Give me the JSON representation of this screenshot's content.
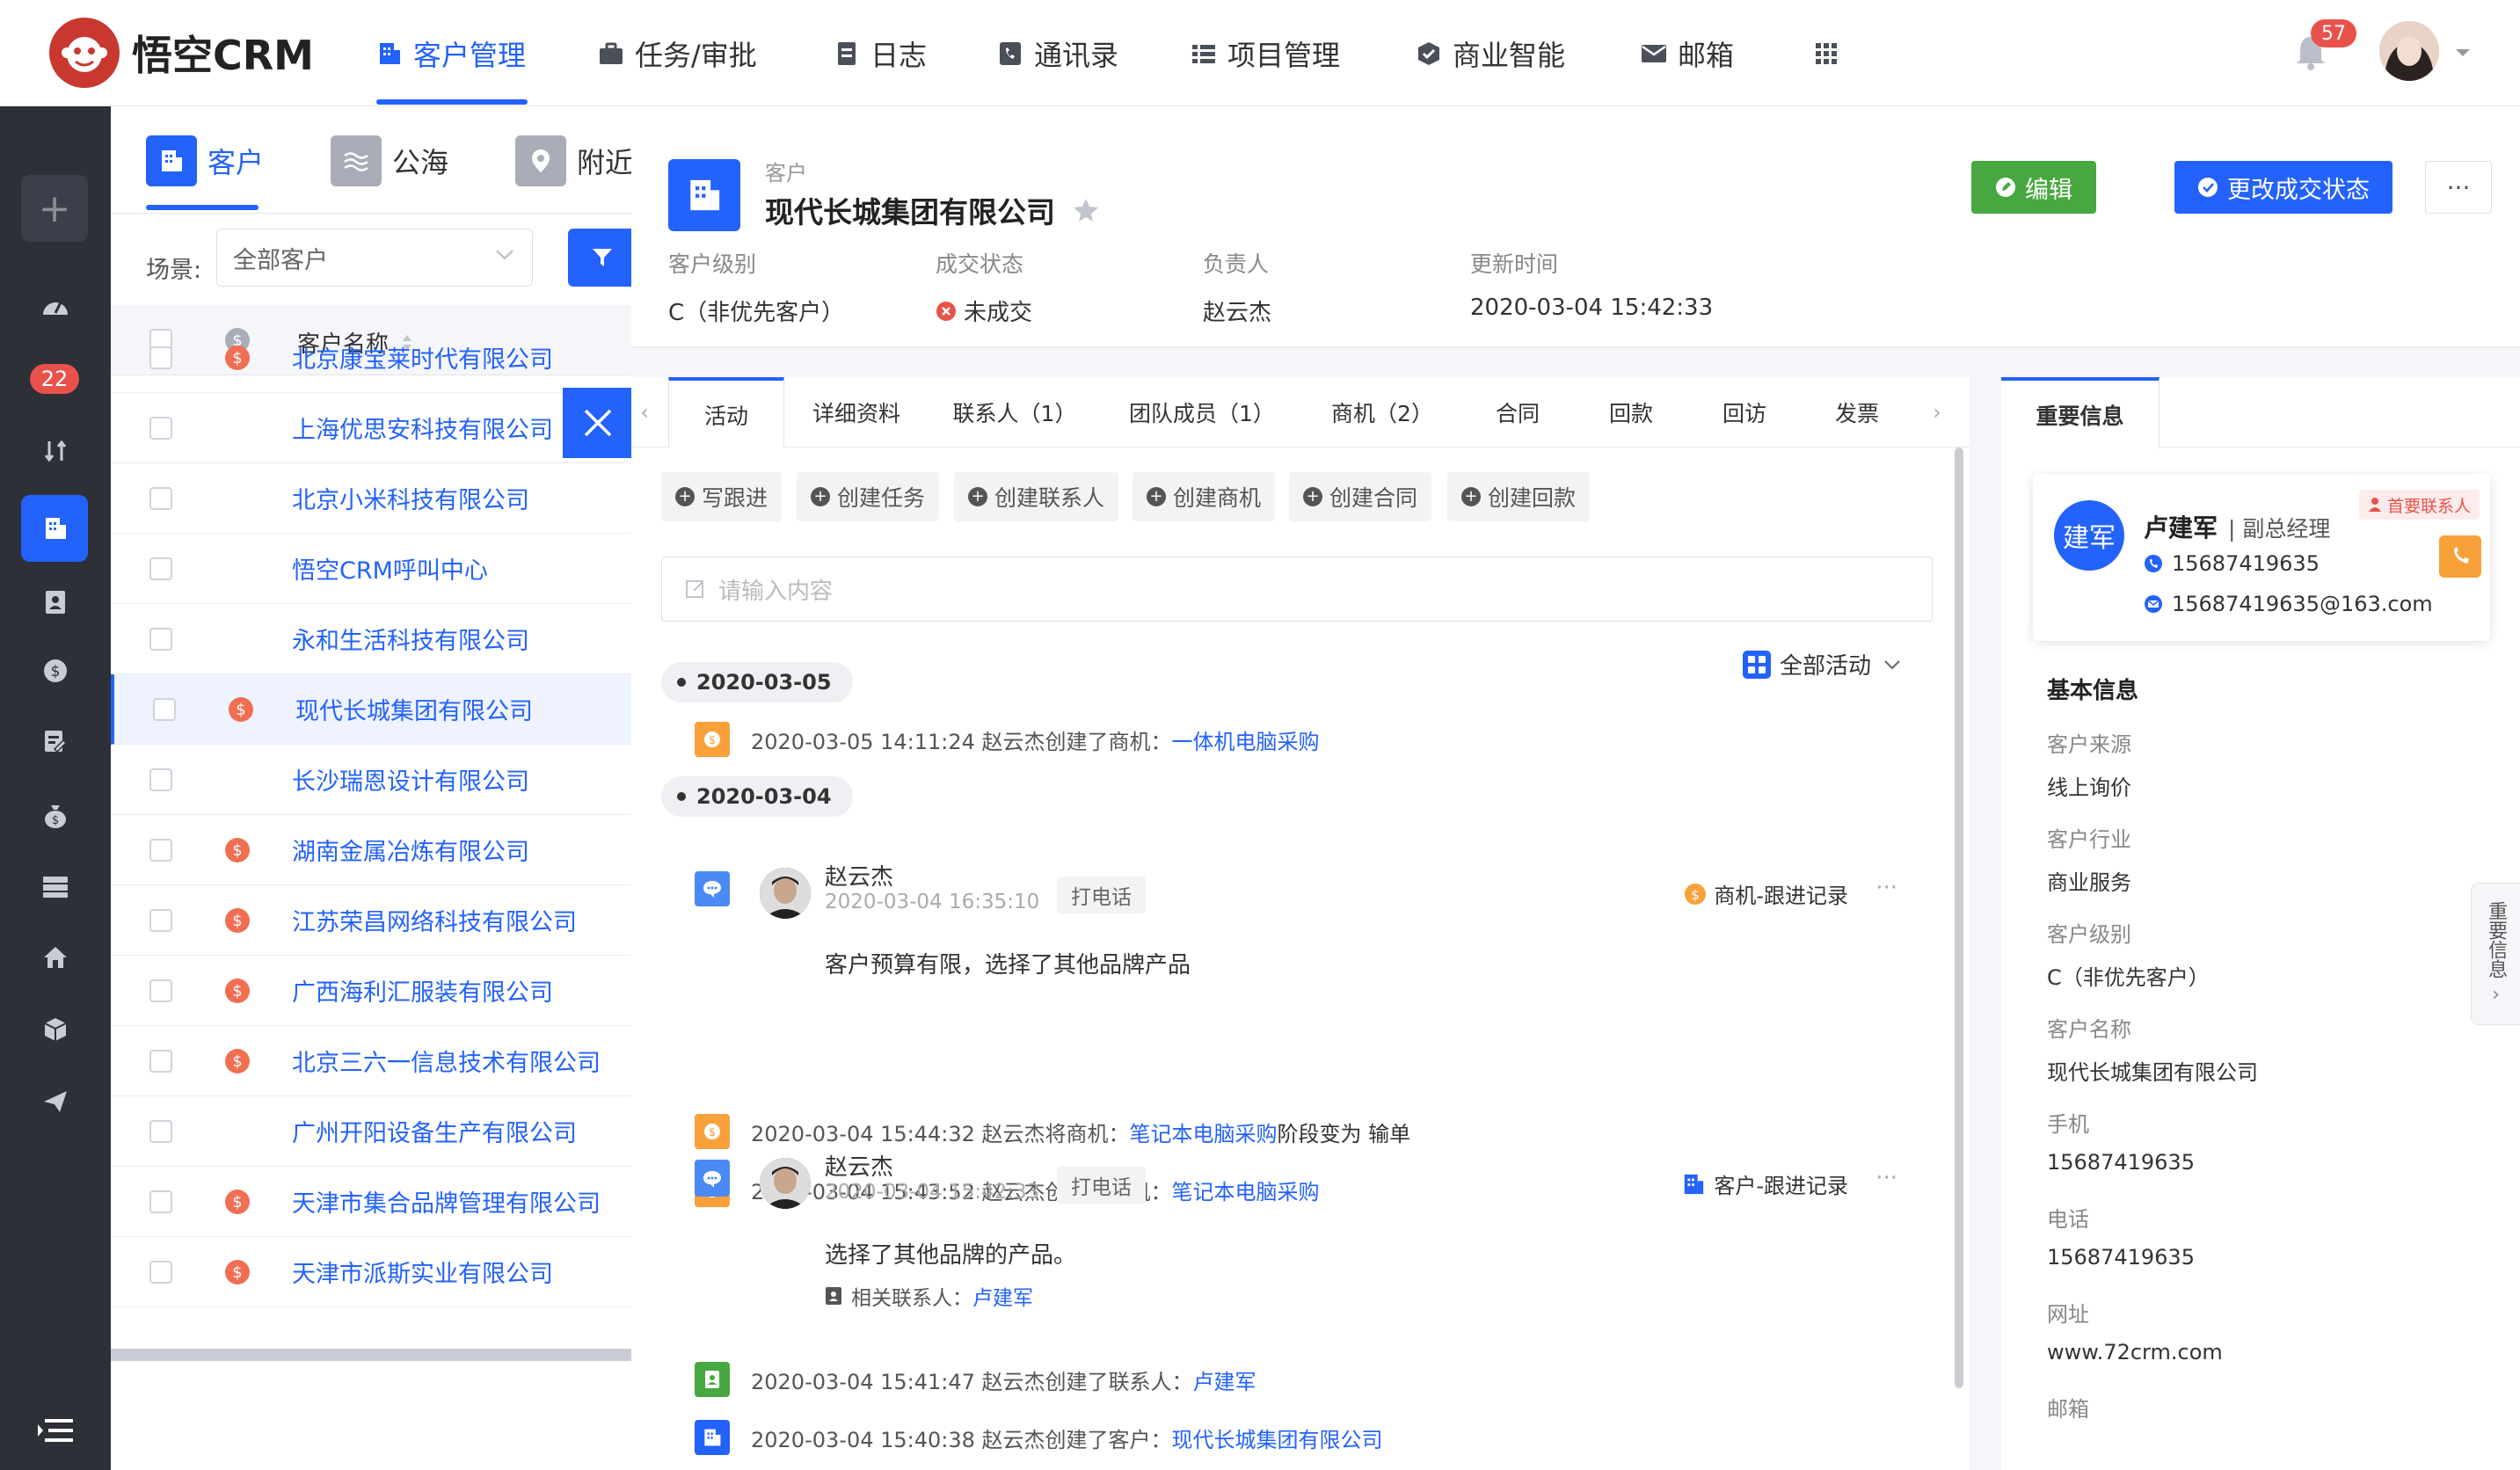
{
  "app": {
    "logo_text": "悟空CRM"
  },
  "nav": {
    "items": [
      {
        "label": "客户管理",
        "icon": "customer-icon",
        "active": true
      },
      {
        "label": "任务/审批",
        "icon": "briefcase-icon"
      },
      {
        "label": "日志",
        "icon": "log-icon"
      },
      {
        "label": "通讯录",
        "icon": "contacts-icon"
      },
      {
        "label": "项目管理",
        "icon": "project-icon"
      },
      {
        "label": "商业智能",
        "icon": "bi-icon"
      },
      {
        "label": "邮箱",
        "icon": "mail-icon"
      }
    ],
    "notification_count": "57"
  },
  "sidebar": {
    "badge": "22"
  },
  "left_panel": {
    "tabs": [
      {
        "label": "客户",
        "active": true
      },
      {
        "label": "公海"
      },
      {
        "label": "附近客户"
      }
    ],
    "scene_label": "场景:",
    "scene_value": "全部客户",
    "column_header": "客户名称",
    "rows": [
      {
        "name": "北京康宝莱时代有限公司",
        "deal": true
      },
      {
        "name": "上海优思安科技有限公司",
        "deal": false
      },
      {
        "name": "北京小米科技有限公司",
        "deal": false
      },
      {
        "name": "悟空CRM呼叫中心",
        "deal": false
      },
      {
        "name": "永和生活科技有限公司",
        "deal": false
      },
      {
        "name": "现代长城集团有限公司",
        "deal": true,
        "selected": true
      },
      {
        "name": "长沙瑞恩设计有限公司",
        "deal": false
      },
      {
        "name": "湖南金属冶炼有限公司",
        "deal": true
      },
      {
        "name": "江苏荣昌网络科技有限公司",
        "deal": true
      },
      {
        "name": "广西海利汇服装有限公司",
        "deal": true
      },
      {
        "name": "北京三六一信息技术有限公司",
        "deal": true
      },
      {
        "name": "广州开阳设备生产有限公司",
        "deal": false
      },
      {
        "name": "天津市集合品牌管理有限公司",
        "deal": true
      },
      {
        "name": "天津市派斯实业有限公司",
        "deal": true
      }
    ]
  },
  "detail": {
    "subtitle": "客户",
    "title": "现代长城集团有限公司",
    "edit_label": "编辑",
    "status_label": "更改成交状态",
    "more_label": "···",
    "meta": [
      {
        "label": "客户级别",
        "value": "C（非优先客户）"
      },
      {
        "label": "成交状态",
        "value": "未成交"
      },
      {
        "label": "负责人",
        "value": "赵云杰"
      },
      {
        "label": "更新时间",
        "value": "2020-03-04 15:42:33"
      }
    ],
    "tabs": [
      "活动",
      "详细资料",
      "联系人（1）",
      "团队成员（1）",
      "商机（2）",
      "合同",
      "回款",
      "回访",
      "发票"
    ],
    "actions": [
      "写跟进",
      "创建任务",
      "创建联系人",
      "创建商机",
      "创建合同",
      "创建回款"
    ],
    "input_placeholder": "请输入内容",
    "filter_label": "全部活动",
    "timeline": {
      "date1": "2020-03-05",
      "date2": "2020-03-04",
      "e1": {
        "text": "2020-03-05 14:11:24 赵云杰创建了商机：",
        "link": "一体机电脑采购"
      },
      "card1": {
        "name": "赵云杰",
        "time": "2020-03-04 16:35:10",
        "type": "打电话",
        "tag": "商机-跟进记录",
        "text": "客户预算有限，选择了其他品牌产品"
      },
      "e2": {
        "text": "2020-03-04 15:44:32 赵云杰将商机：",
        "link": "笔记本电脑采购",
        "suffix": " 阶段变为 输单"
      },
      "e3": {
        "text": "2020-03-04 15:43:52 赵云杰创建了商机：",
        "link": "笔记本电脑采购"
      },
      "card2": {
        "name": "赵云杰",
        "time": "2020-03-04 15:42:33",
        "type": "打电话",
        "tag": "客户-跟进记录",
        "text": "选择了其他品牌的产品。",
        "contact_label": "相关联系人：",
        "contact": "卢建军"
      },
      "e4": {
        "text": "2020-03-04 15:41:47 赵云杰创建了联系人：",
        "link": "卢建军"
      },
      "e5": {
        "text": "2020-03-04 15:40:38 赵云杰创建了客户：",
        "link": "现代长城集团有限公司"
      }
    }
  },
  "right_panel": {
    "tab": "重要信息",
    "contact": {
      "avatar_text": "建军",
      "name": "卢建军",
      "role": "| 副总经理",
      "badge": "首要联系人",
      "phone": "15687419635",
      "email": "15687419635@163.com"
    },
    "basic_title": "基本信息",
    "fields": [
      {
        "label": "客户来源",
        "value": "线上询价"
      },
      {
        "label": "客户行业",
        "value": "商业服务"
      },
      {
        "label": "客户级别",
        "value": "C（非优先客户）"
      },
      {
        "label": "客户名称",
        "value": "现代长城集团有限公司"
      },
      {
        "label": "手机",
        "value": "15687419635"
      },
      {
        "label": "电话",
        "value": "15687419635"
      },
      {
        "label": "网址",
        "value": "www.72crm.com"
      },
      {
        "label": "邮箱",
        "value": ""
      }
    ],
    "side_handle": "重要信息"
  },
  "colors": {
    "primary": "#2362fb",
    "success": "#47a841",
    "danger": "#e9524a",
    "deal": "#f06e51",
    "sidebar": "#2d3037"
  }
}
